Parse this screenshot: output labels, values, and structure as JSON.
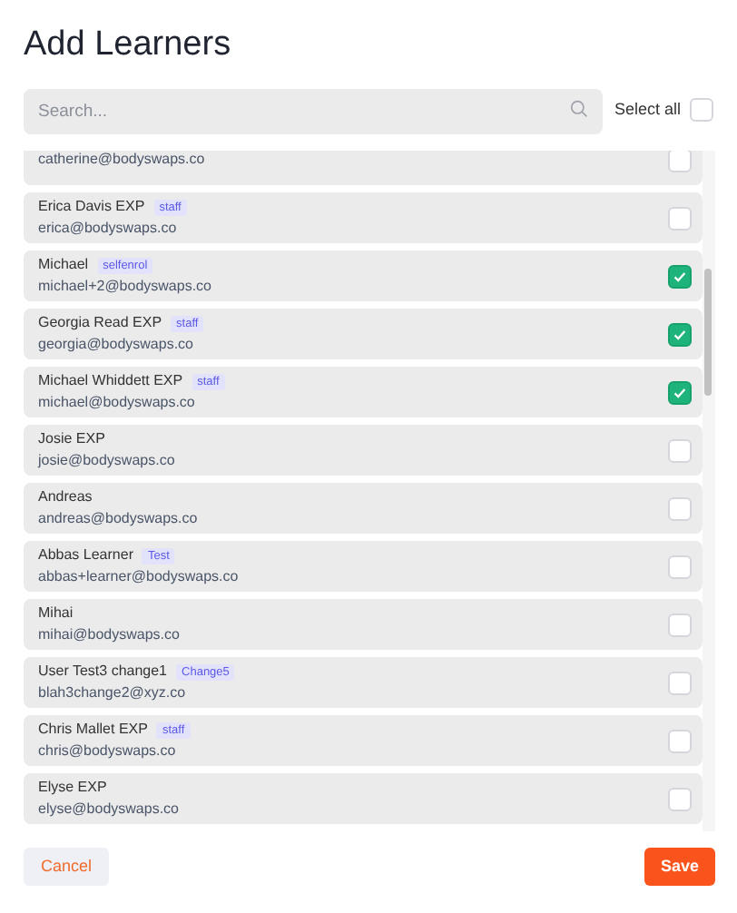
{
  "title": "Add Learners",
  "search": {
    "placeholder": "Search..."
  },
  "select_all": {
    "label": "Select all",
    "checked": false
  },
  "learners": [
    {
      "email": "catherine@bodyswaps.co",
      "checked": false
    },
    {
      "name": "Erica Davis EXP",
      "tag": "staff",
      "email": "erica@bodyswaps.co",
      "checked": false
    },
    {
      "name": "Michael",
      "tag": "selfenrol",
      "email": "michael+2@bodyswaps.co",
      "checked": true
    },
    {
      "name": "Georgia Read EXP",
      "tag": "staff",
      "email": "georgia@bodyswaps.co",
      "checked": true
    },
    {
      "name": "Michael Whiddett EXP",
      "tag": "staff",
      "email": "michael@bodyswaps.co",
      "checked": true
    },
    {
      "name": "Josie EXP",
      "email": "josie@bodyswaps.co",
      "checked": false
    },
    {
      "name": "Andreas",
      "email": "andreas@bodyswaps.co",
      "checked": false
    },
    {
      "name": "Abbas Learner",
      "tag": "Test",
      "email": "abbas+learner@bodyswaps.co",
      "checked": false
    },
    {
      "name": "Mihai",
      "email": "mihai@bodyswaps.co",
      "checked": false
    },
    {
      "name": "User Test3 change1",
      "tag": "Change5",
      "email": "blah3change2@xyz.co",
      "checked": false
    },
    {
      "name": "Chris Mallet EXP",
      "tag": "staff",
      "email": "chris@bodyswaps.co",
      "checked": false
    },
    {
      "name": "Elyse EXP",
      "email": "elyse@bodyswaps.co",
      "checked": false
    }
  ],
  "buttons": {
    "cancel": "Cancel",
    "save": "Save"
  }
}
